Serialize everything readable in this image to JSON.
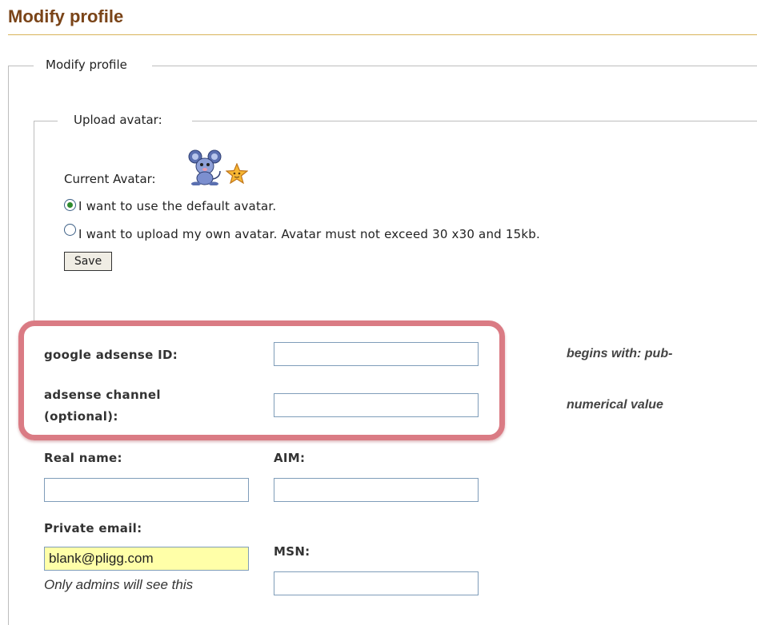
{
  "page_title": "Modify profile",
  "profile_fieldset": {
    "legend": "Modify profile"
  },
  "avatar_fieldset": {
    "legend": "Upload avatar:",
    "current_avatar_label": "Current Avatar:",
    "options": [
      {
        "label": "I want to use the default avatar.",
        "checked": true
      },
      {
        "label": "I want to upload my own avatar. Avatar must not exceed 30 x30 and 15kb.",
        "checked": false
      }
    ],
    "save_label": "Save"
  },
  "adsense": {
    "id_label": "google adsense ID:",
    "id_value": "",
    "id_hint": "begins with: pub-",
    "channel_label_line1": "adsense channel",
    "channel_label_line2": "(optional):",
    "channel_value": "",
    "channel_hint": "numerical value"
  },
  "personal": {
    "real_name_label": "Real name:",
    "real_name_value": "",
    "aim_label": "AIM:",
    "aim_value": "",
    "email_label": "Private email:",
    "email_value": "blank@pligg.com",
    "email_note": "Only admins will see this",
    "msn_label": "MSN:",
    "msn_value": ""
  },
  "colors": {
    "title": "#7a4418",
    "highlight_border": "#da7b84",
    "email_field_bg": "#ffffa8"
  }
}
